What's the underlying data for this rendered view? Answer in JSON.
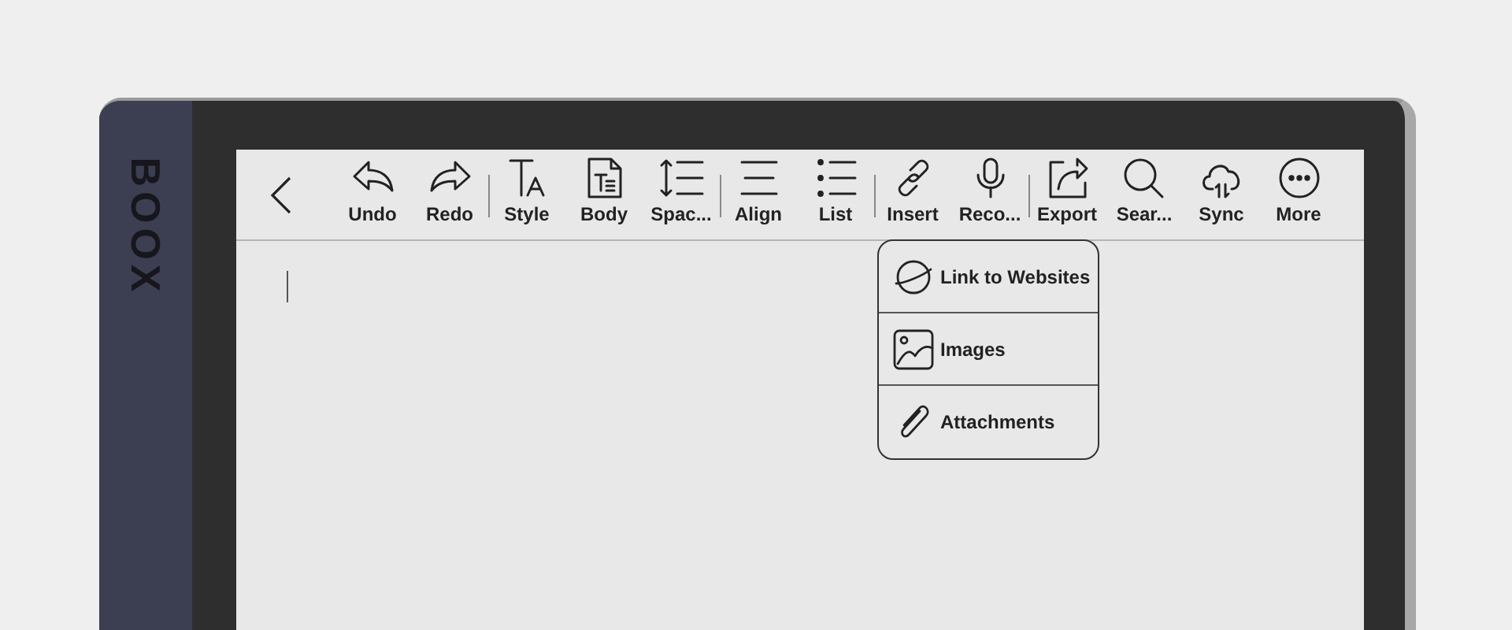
{
  "device": {
    "logo": "BOOX"
  },
  "toolbar": {
    "items": [
      {
        "label": "Undo",
        "divider_before": false
      },
      {
        "label": "Redo",
        "divider_before": false
      },
      {
        "label": "Style",
        "divider_before": true
      },
      {
        "label": "Body",
        "divider_before": false
      },
      {
        "label": "Spac...",
        "divider_before": false
      },
      {
        "label": "Align",
        "divider_before": true
      },
      {
        "label": "List",
        "divider_before": false
      },
      {
        "label": "Insert",
        "divider_before": true
      },
      {
        "label": "Reco...",
        "divider_before": false
      },
      {
        "label": "Export",
        "divider_before": true
      },
      {
        "label": "Sear...",
        "divider_before": false
      },
      {
        "label": "Sync",
        "divider_before": false
      },
      {
        "label": "More",
        "divider_before": false
      }
    ]
  },
  "insert_menu": {
    "items": [
      {
        "label": "Link to Websites"
      },
      {
        "label": "Images"
      },
      {
        "label": "Attachments"
      }
    ]
  }
}
